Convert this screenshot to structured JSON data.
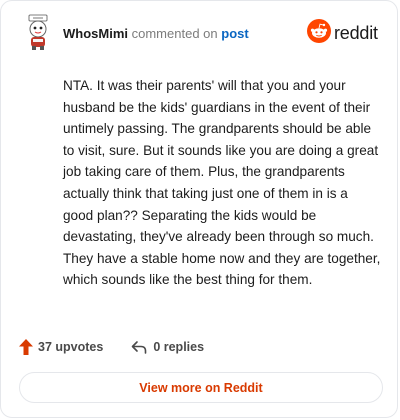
{
  "header": {
    "username": "WhosMimi",
    "action": "commented on",
    "target": "post",
    "logo_text": "reddit"
  },
  "comment": {
    "text": "NTA. It was their parents' will that you and your husband be the kids' guardians in the event of their untimely passing. The grandparents should be able to visit, sure. But it sounds like you are doing a great job taking care of them. Plus, the grandparents actually think that taking just one of them in is a good plan?? Separating the kids would be devastating, they've already been through so much. They have a stable home now and they are together, which sounds like the best thing for them."
  },
  "footer": {
    "upvotes": "37 upvotes",
    "replies": "0 replies"
  },
  "view_more_label": "View more on Reddit",
  "colors": {
    "brand": "#ff4500",
    "upvote": "#d93a00",
    "link": "#0a66c2"
  },
  "icons": {
    "logo": "reddit-snoo-icon",
    "upvote": "arrow-up-icon",
    "reply": "reply-arrow-icon"
  }
}
